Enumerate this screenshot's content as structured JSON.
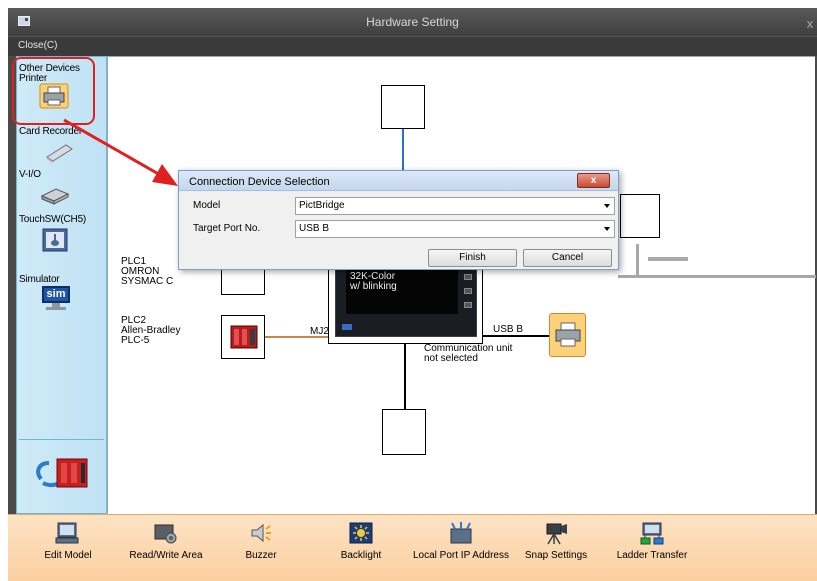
{
  "window": {
    "title": "Hardware Setting",
    "close_glyph": "x"
  },
  "menu": {
    "close_label": "Close(C)"
  },
  "sidebar": {
    "items": [
      {
        "label": "Other Devices\nPrinter",
        "icon": "printer-icon"
      },
      {
        "label": "Card Recorder",
        "icon": "card-recorder-icon"
      },
      {
        "label": "V-I/O",
        "icon": "vio-icon"
      },
      {
        "label": "TouchSW(CH5)",
        "icon": "touch-switch-icon"
      },
      {
        "label": "Simulator",
        "icon": "simulator-icon",
        "badge": "sim"
      }
    ]
  },
  "diagram": {
    "plc1": "PLC1\nOMRON\nSYSMAC C",
    "plc2": "PLC2\nAllen-Bradley\nPLC-5",
    "mj2": "MJ2",
    "usb_b": "USB B",
    "screen_text": "32K-Color\nw/ blinking",
    "comm_unit": "Communication unit\nnot selected"
  },
  "dialog": {
    "title": "Connection Device Selection",
    "close_glyph": "x",
    "model_label": "Model",
    "model_value": "PictBridge",
    "port_label": "Target Port No.",
    "port_value": "USB B",
    "finish_label": "Finish",
    "cancel_label": "Cancel"
  },
  "toolbar": [
    {
      "label": "Edit Model",
      "icon": "edit-model-icon"
    },
    {
      "label": "Read/Write Area",
      "icon": "read-write-area-icon"
    },
    {
      "label": "Buzzer",
      "icon": "buzzer-icon"
    },
    {
      "label": "Backlight",
      "icon": "backlight-icon"
    },
    {
      "label": "Local Port IP Address",
      "icon": "ip-address-icon"
    },
    {
      "label": "Snap Settings",
      "icon": "snap-settings-icon"
    },
    {
      "label": "Ladder Transfer",
      "icon": "ladder-transfer-icon"
    }
  ],
  "colors": {
    "highlight": "#e02020",
    "sidebar": "#c4e4f5",
    "toolbar": "#fcd7ae",
    "dialog_close": "#c94a35"
  }
}
